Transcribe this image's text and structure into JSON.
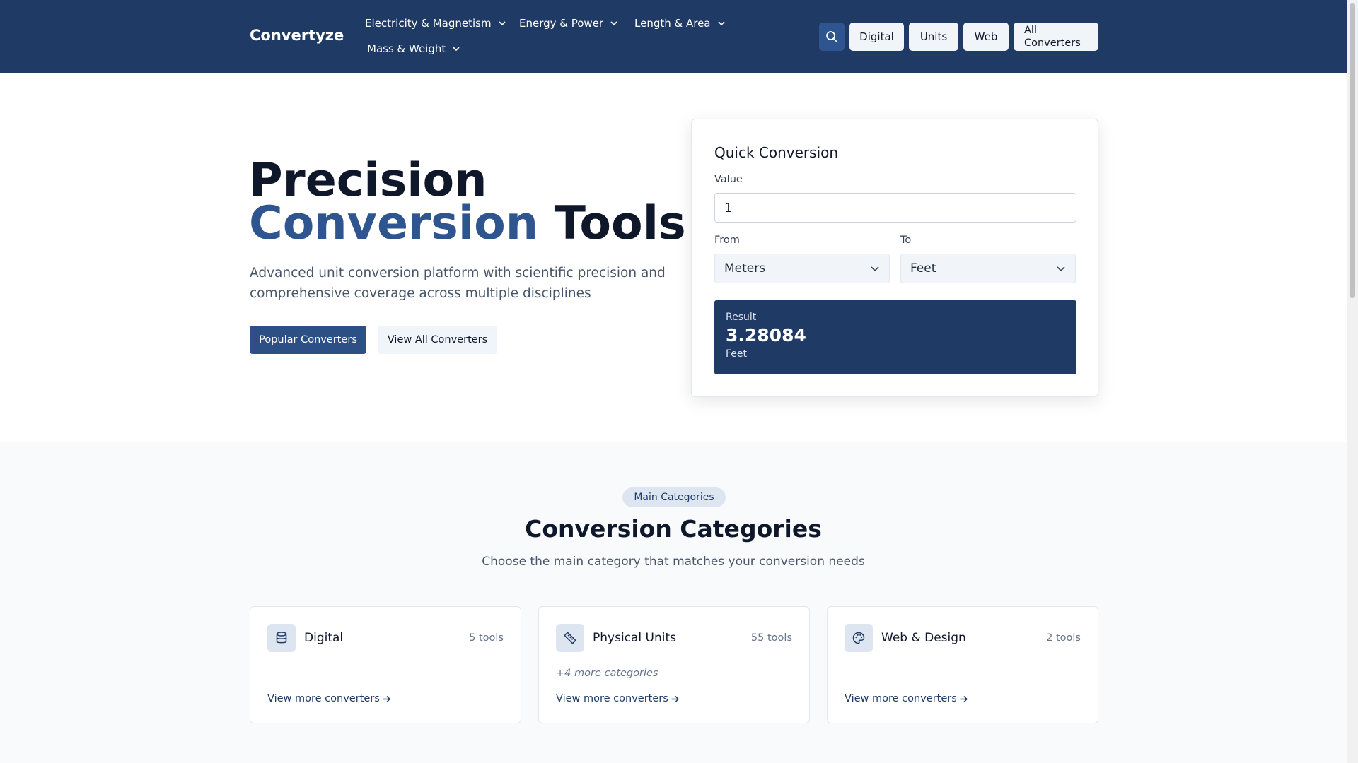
{
  "header": {
    "logo": "Convertyze",
    "nav": [
      {
        "label": "Electricity & Magnetism"
      },
      {
        "label": "Energy & Power"
      },
      {
        "label": "Length & Area"
      },
      {
        "label": "Mass & Weight"
      }
    ],
    "buttons": {
      "digital": "Digital",
      "units": "Units",
      "web": "Web",
      "all_line1": "All",
      "all_line2": "Converters"
    }
  },
  "hero": {
    "title_line1": "Precision",
    "title_accent": "Conversion",
    "title_rest": " Tools",
    "subtitle": "Advanced unit conversion platform with scientific precision and comprehensive coverage across multiple disciplines",
    "primary_button": "Popular Converters",
    "secondary_button": "View All Converters"
  },
  "quick_conversion": {
    "title": "Quick Conversion",
    "value_label": "Value",
    "value": "1",
    "from_label": "From",
    "from_value": "Meters",
    "to_label": "To",
    "to_value": "Feet",
    "result_label": "Result",
    "result_value": "3.28084",
    "result_unit": "Feet"
  },
  "categories": {
    "badge": "Main Categories",
    "title": "Conversion Categories",
    "subtitle": "Choose the main category that matches your conversion needs",
    "cards": [
      {
        "name": "Digital",
        "count": "5 tools",
        "more": "",
        "link": "View more converters",
        "icon": "database-icon"
      },
      {
        "name": "Physical Units",
        "count": "55 tools",
        "more": "+4 more categories",
        "link": "View more converters",
        "icon": "ruler-icon"
      },
      {
        "name": "Web & Design",
        "count": "2 tools",
        "more": "",
        "link": "View more converters",
        "icon": "palette-icon"
      }
    ]
  },
  "colors": {
    "primary": "#1f3a64",
    "accent": "#2f5590",
    "background_alt": "#f8fafc"
  }
}
